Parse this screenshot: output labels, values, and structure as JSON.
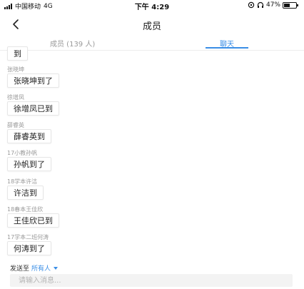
{
  "status_bar": {
    "carrier": "中国移动",
    "network": "4G",
    "time": "下午 4:29",
    "battery_percent": "47%",
    "battery_level": 0.47
  },
  "nav": {
    "back_icon": "chevron-left-icon",
    "title": "成员"
  },
  "tabs": [
    {
      "label": "成员 (139 人)",
      "active": false
    },
    {
      "label": "聊天",
      "active": true
    }
  ],
  "messages": [
    {
      "sender": "",
      "text": "到"
    },
    {
      "sender": "张晓坤",
      "text": "张晓坤到了"
    },
    {
      "sender": "徐增凤",
      "text": "徐增凤已到"
    },
    {
      "sender": "薛睿英",
      "text": "薛睿英到"
    },
    {
      "sender": "17小教孙帆",
      "text": "孙帆到了"
    },
    {
      "sender": "18学本许洁",
      "text": "许洁到"
    },
    {
      "sender": "18春本王佳欣",
      "text": "王佳欣已到"
    },
    {
      "sender": "17学本二班何涛",
      "text": "何涛到了"
    }
  ],
  "composer": {
    "send_to_label": "发送至",
    "recipient": "所有人",
    "placeholder": "请输入消息..."
  },
  "colors": {
    "accent": "#3a8ee6",
    "muted_text": "#9a9a9a",
    "input_bg": "#f3f3f3"
  }
}
